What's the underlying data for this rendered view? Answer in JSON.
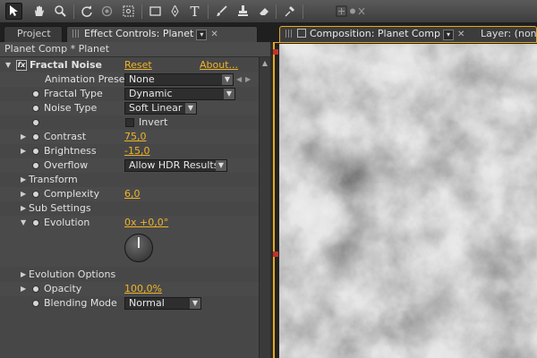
{
  "toolbar": {
    "icons": [
      "arrow-icon",
      "hand-icon",
      "zoom-icon",
      "rotate-icon",
      "orbit-camera-icon",
      "pan-behind-icon",
      "rectangle-icon",
      "pen-icon",
      "text-icon",
      "brush-icon",
      "clone-stamp-icon",
      "eraser-icon",
      "puppet-pin-icon",
      "axis-icon"
    ],
    "text_tool_glyph": "T"
  },
  "tabs": {
    "project": "Project",
    "effect_controls": "Effect Controls: Planet",
    "composition": "Composition: Planet Comp",
    "layer": "Layer: (none)"
  },
  "effect_controls": {
    "header": "Planet Comp * Planet",
    "effect_name": "Fractal Noise",
    "fx_badge": "fx",
    "reset": "Reset",
    "about": "About...",
    "presets_label": "Animation Presets:",
    "presets_value": "None",
    "rows": {
      "fractal_type": {
        "label": "Fractal Type",
        "value": "Dynamic"
      },
      "noise_type": {
        "label": "Noise Type",
        "value": "Soft Linear"
      },
      "invert": {
        "label": "Invert",
        "checked": false
      },
      "contrast": {
        "label": "Contrast",
        "value": "75,0"
      },
      "brightness": {
        "label": "Brightness",
        "value": "-15,0"
      },
      "overflow": {
        "label": "Overflow",
        "value": "Allow HDR Results"
      },
      "transform": {
        "label": "Transform"
      },
      "complexity": {
        "label": "Complexity",
        "value": "6,0"
      },
      "sub_settings": {
        "label": "Sub Settings"
      },
      "evolution": {
        "label": "Evolution",
        "value": "0x +0,0°"
      },
      "evolution_options": {
        "label": "Evolution Options"
      },
      "opacity": {
        "label": "Opacity",
        "value": "100,0%"
      },
      "blending_mode": {
        "label": "Blending Mode",
        "value": "Normal"
      }
    }
  },
  "colors": {
    "accent": "#e8a917",
    "value": "#f0b428",
    "panel": "#474747"
  }
}
